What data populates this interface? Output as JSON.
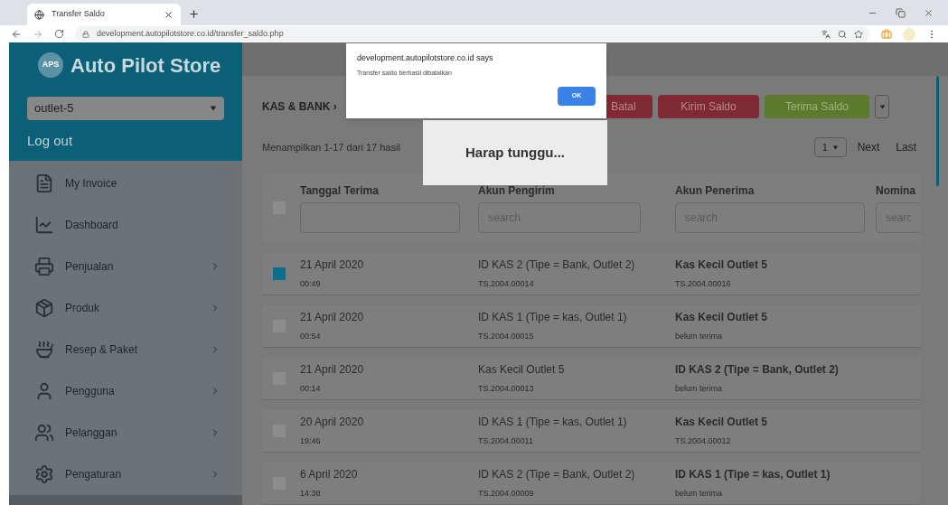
{
  "browser": {
    "tab_title": "Transfer Saldo",
    "url": "development.autopilotstore.co.id/transfer_saldo.php"
  },
  "sidebar": {
    "brand": "Auto Pilot Store",
    "logo_text": "APS",
    "outlet": "outlet-5",
    "logout": "Log out",
    "items": [
      {
        "label": "My Invoice",
        "has_submenu": false
      },
      {
        "label": "Dashboard",
        "has_submenu": false
      },
      {
        "label": "Penjualan",
        "has_submenu": true
      },
      {
        "label": "Produk",
        "has_submenu": true
      },
      {
        "label": "Resep & Paket",
        "has_submenu": true
      },
      {
        "label": "Pengguna",
        "has_submenu": true
      },
      {
        "label": "Pelanggan",
        "has_submenu": true
      },
      {
        "label": "Pengaturan",
        "has_submenu": true
      }
    ]
  },
  "dialog": {
    "origin": "development.autopilotstore.co.id says",
    "message": "Transfer saldo berhasil dibatalkan",
    "ok": "OK"
  },
  "loading": {
    "text": "Harap tunggu..."
  },
  "breadcrumb": "KAS & BANK ›",
  "actions": [
    {
      "label": "Batal",
      "kind": "danger"
    },
    {
      "label": "Kirim Saldo",
      "kind": "danger"
    },
    {
      "label": "Terima Saldo",
      "kind": "success"
    }
  ],
  "summary": "Menampilkan 1-17 dari 17 hasil",
  "pagination": {
    "page": "1",
    "next": "Next",
    "last": "Last"
  },
  "table": {
    "header_checked": false,
    "columns": [
      {
        "label": "Tanggal Terima"
      },
      {
        "label": "Akun Pengirim",
        "placeholder": "search"
      },
      {
        "label": "Akun Penerima",
        "placeholder": "search"
      },
      {
        "label": "Nomina",
        "placeholder": "searc"
      }
    ],
    "rows": [
      {
        "selected": true,
        "date": "21 April 2020",
        "time": "00:49",
        "sender": "ID KAS 2 (Tipe = Bank, Outlet 2)",
        "sender_code": "TS.2004.00014",
        "receiver": "Kas Kecil Outlet 5",
        "receiver_code": "TS.2004.00016"
      },
      {
        "selected": false,
        "date": "21 April 2020",
        "time": "00:54",
        "sender": "ID KAS 1 (Tipe = kas, Outlet 1)",
        "sender_code": "TS.2004.00015",
        "receiver": "Kas Kecil Outlet 5",
        "receiver_code": "belum terima"
      },
      {
        "selected": false,
        "date": "21 April 2020",
        "time": "00:14",
        "sender": "Kas Kecil Outlet 5",
        "sender_code": "TS.2004.00013",
        "receiver": "ID KAS 2 (Tipe = Bank, Outlet 2)",
        "receiver_code": "belum terima"
      },
      {
        "selected": false,
        "date": "20 April 2020",
        "time": "19:46",
        "sender": "ID KAS 1 (Tipe = kas, Outlet 1)",
        "sender_code": "TS.2004.00011",
        "receiver": "Kas Kecil Outlet 5",
        "receiver_code": "TS.2004.00012"
      },
      {
        "selected": false,
        "date": "6 April 2020",
        "time": "14:38",
        "sender": "ID KAS 2 (Tipe = Bank, Outlet 2)",
        "sender_code": "TS.2004.00009",
        "receiver": "ID KAS 1 (Tipe = kas, Outlet 1)",
        "receiver_code": "belum terima"
      }
    ]
  }
}
